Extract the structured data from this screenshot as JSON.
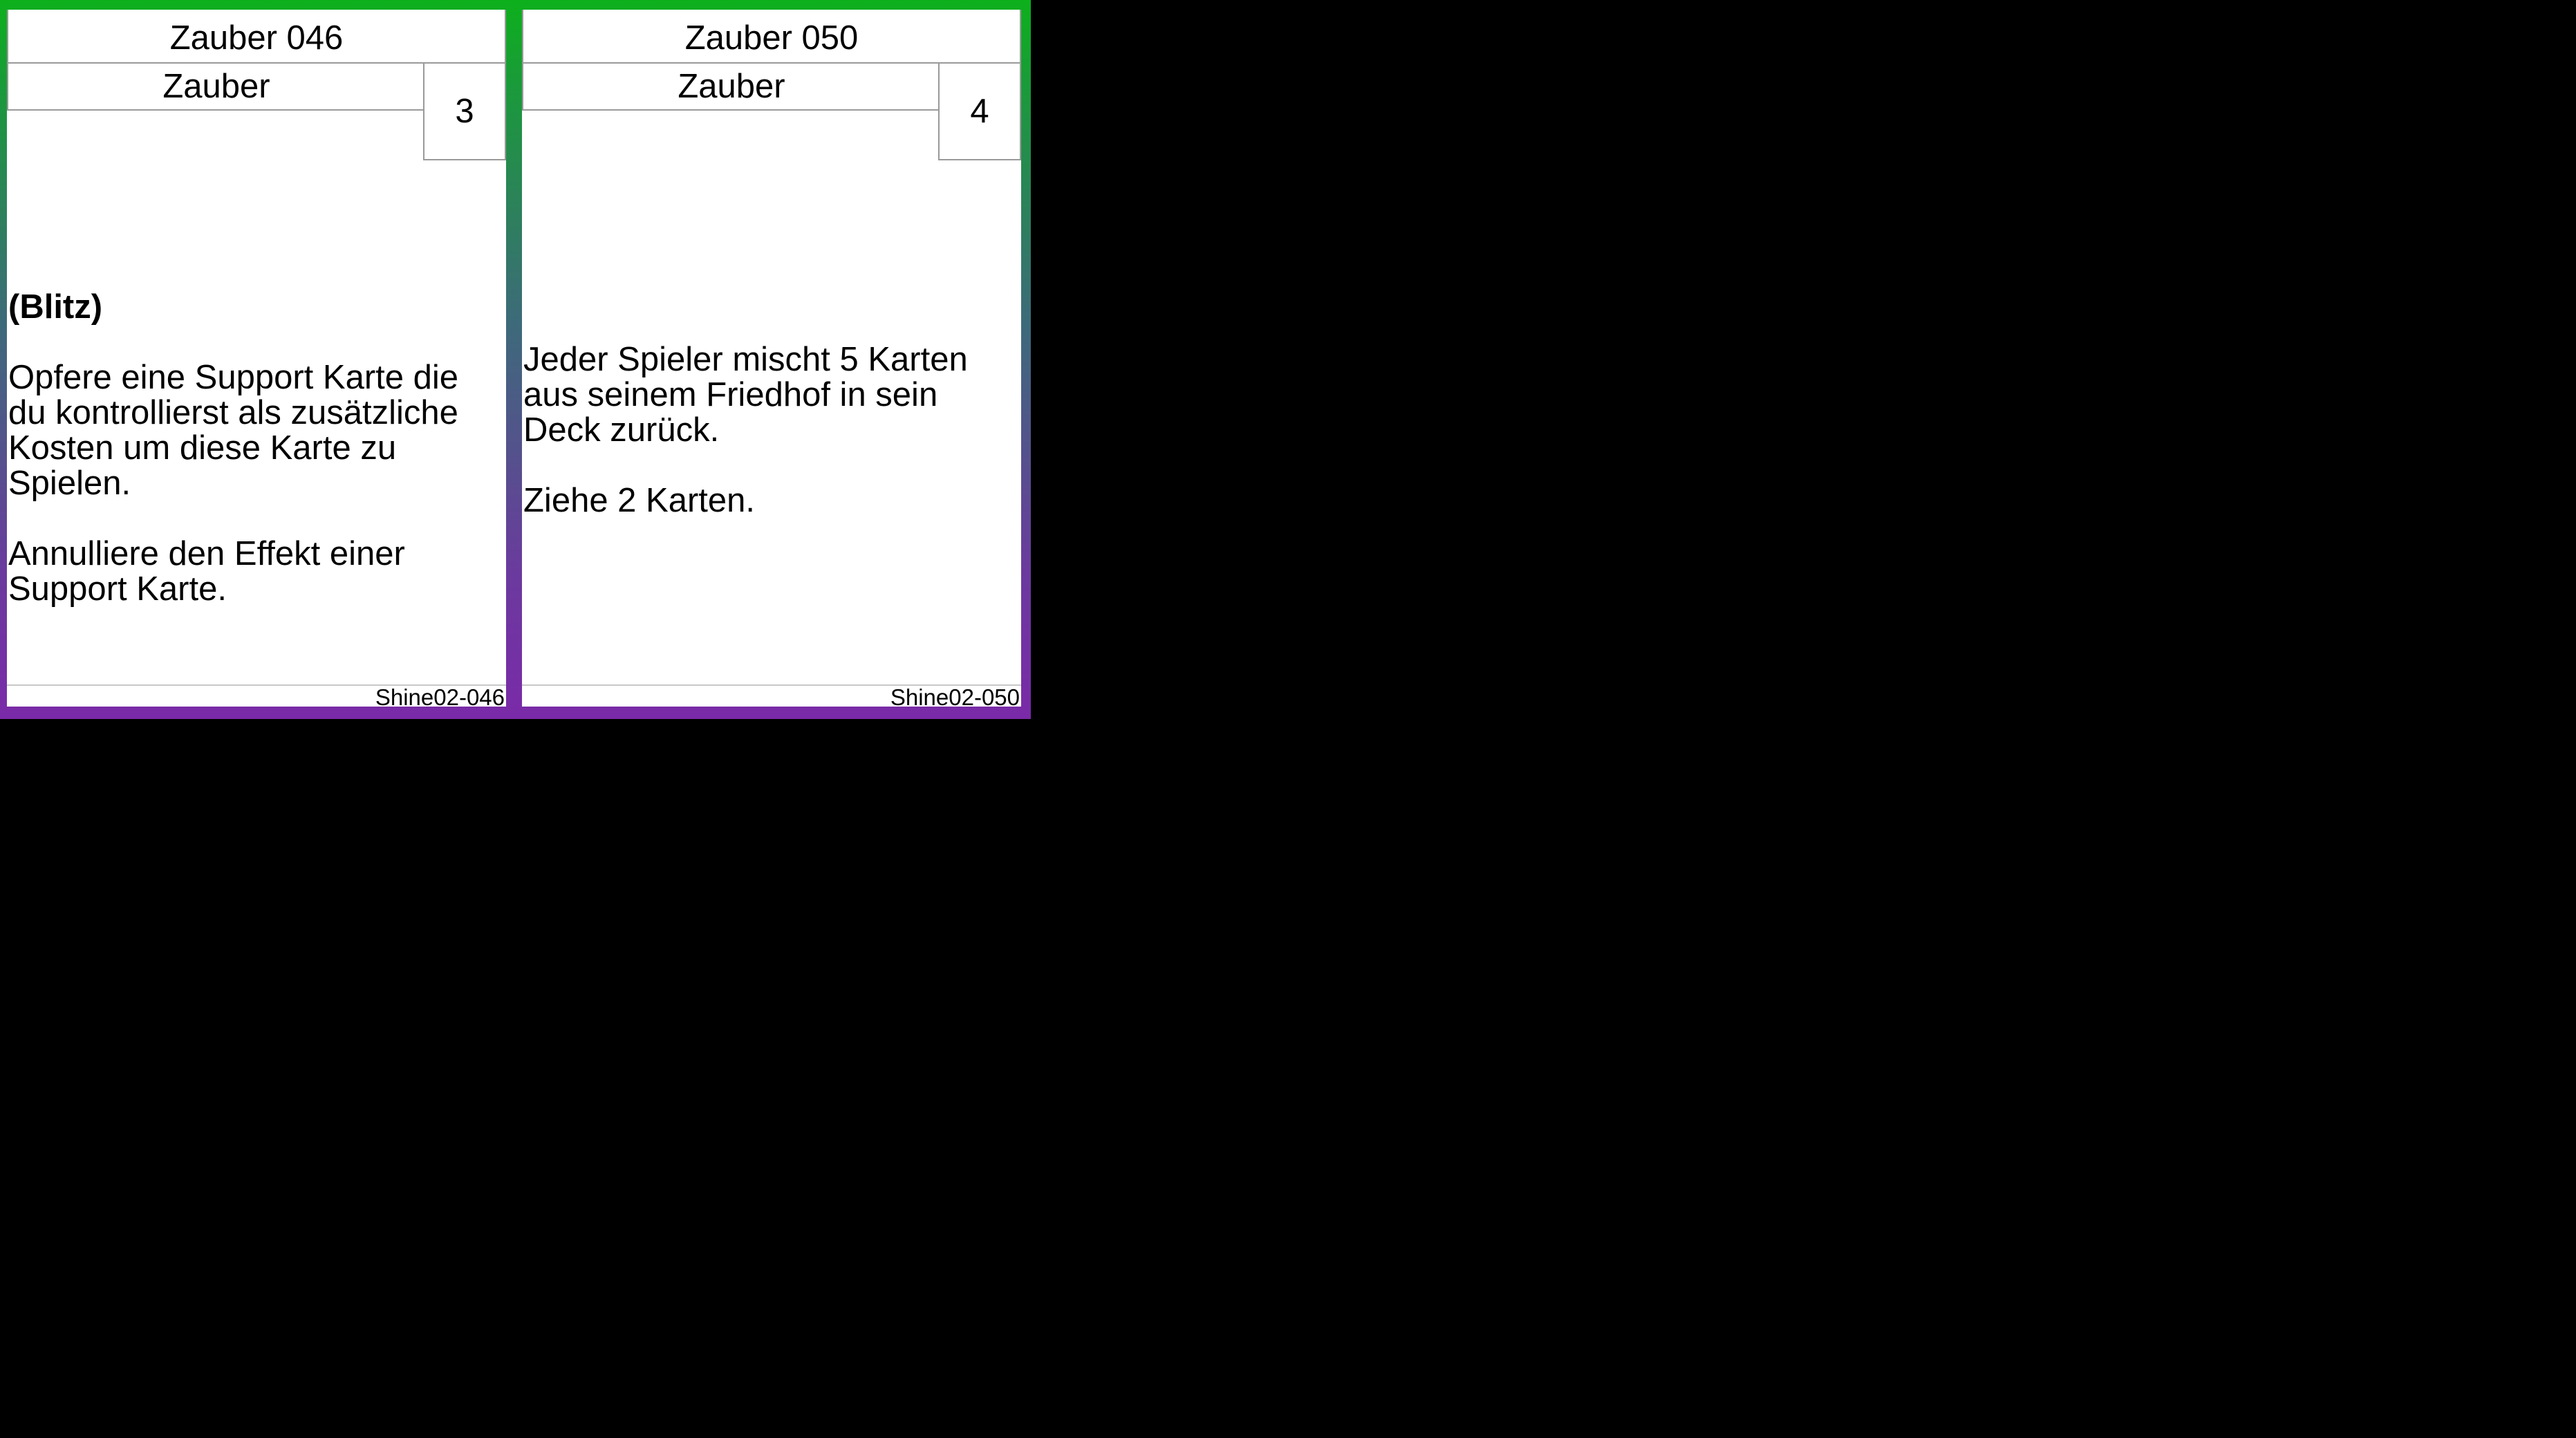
{
  "cards": [
    {
      "name": "Zauber 046",
      "type": "Zauber",
      "cost": "3",
      "keyword": "(Blitz)",
      "text": "Opfere eine Support Karte die\ndu kontrollierst als zusätzliche\nKosten um diese Karte zu\nSpielen.\n\nAnnulliere den Effekt einer\nSupport Karte.",
      "code": "Shine02-046"
    },
    {
      "name": "Zauber 050",
      "type": "Zauber",
      "cost": "4",
      "keyword": "",
      "text": "Jeder Spieler mischt 5 Karten\naus seinem Friedhof in sein\nDeck zurück.\n\nZiehe 2 Karten.",
      "code": "Shine02-050"
    }
  ],
  "colors": {
    "background": "#000000",
    "card_gradient_top": "#0db01c",
    "card_gradient_bottom": "#7a2aa8",
    "card_face": "#ffffff"
  }
}
